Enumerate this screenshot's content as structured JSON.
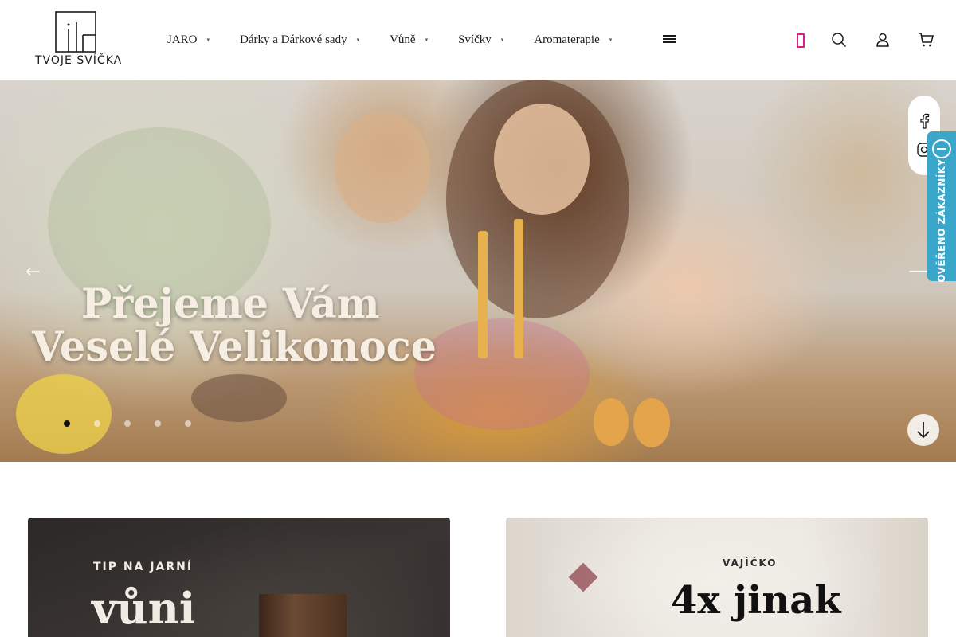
{
  "brand": {
    "name": "TVOJE SVÍČKA"
  },
  "nav": {
    "items": [
      {
        "label": "JARO"
      },
      {
        "label": "Dárky a Dárkové sady"
      },
      {
        "label": "Vůně"
      },
      {
        "label": "Svíčky"
      },
      {
        "label": "Aromaterapie"
      }
    ],
    "caret": "▾"
  },
  "header_icons": [
    "menu-icon",
    "pink-box-icon",
    "search-icon",
    "user-icon",
    "cart-icon"
  ],
  "hero": {
    "title_line1": "Přejeme Vám",
    "title_line2": "Veselé Velikonoce",
    "slides_count": 5,
    "active_slide": 1,
    "prev_arrow": "←",
    "next_arrow": "⟶"
  },
  "social": [
    "facebook-icon",
    "instagram-icon"
  ],
  "badge": {
    "text": "OVĚŘENO ZÁKAZNÍKY"
  },
  "cards": [
    {
      "kicker": "TIP NA JARNÍ",
      "big": "vůni"
    },
    {
      "kicker": "VAJÍČKO",
      "big": "4x jinak"
    }
  ],
  "colors": {
    "accent": "#d61f8a",
    "badge": "#3aa6c9"
  }
}
